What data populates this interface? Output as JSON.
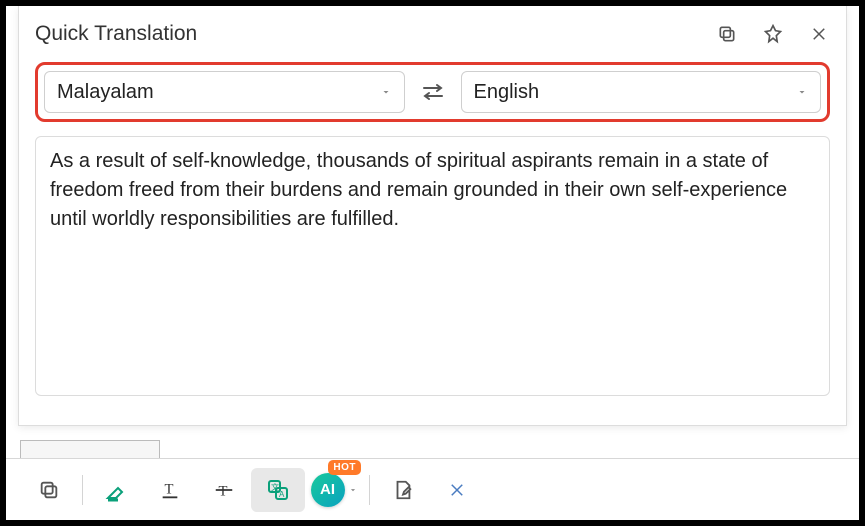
{
  "header": {
    "title": "Quick Translation"
  },
  "languages": {
    "source": "Malayalam",
    "target": "English"
  },
  "translation": {
    "text": "As a result of self-knowledge, thousands of spiritual aspirants remain in a state of freedom freed from their burdens and remain grounded in their own self-experience until worldly responsibilities are fulfilled."
  },
  "ai": {
    "label": "AI",
    "badge": "HOT"
  }
}
